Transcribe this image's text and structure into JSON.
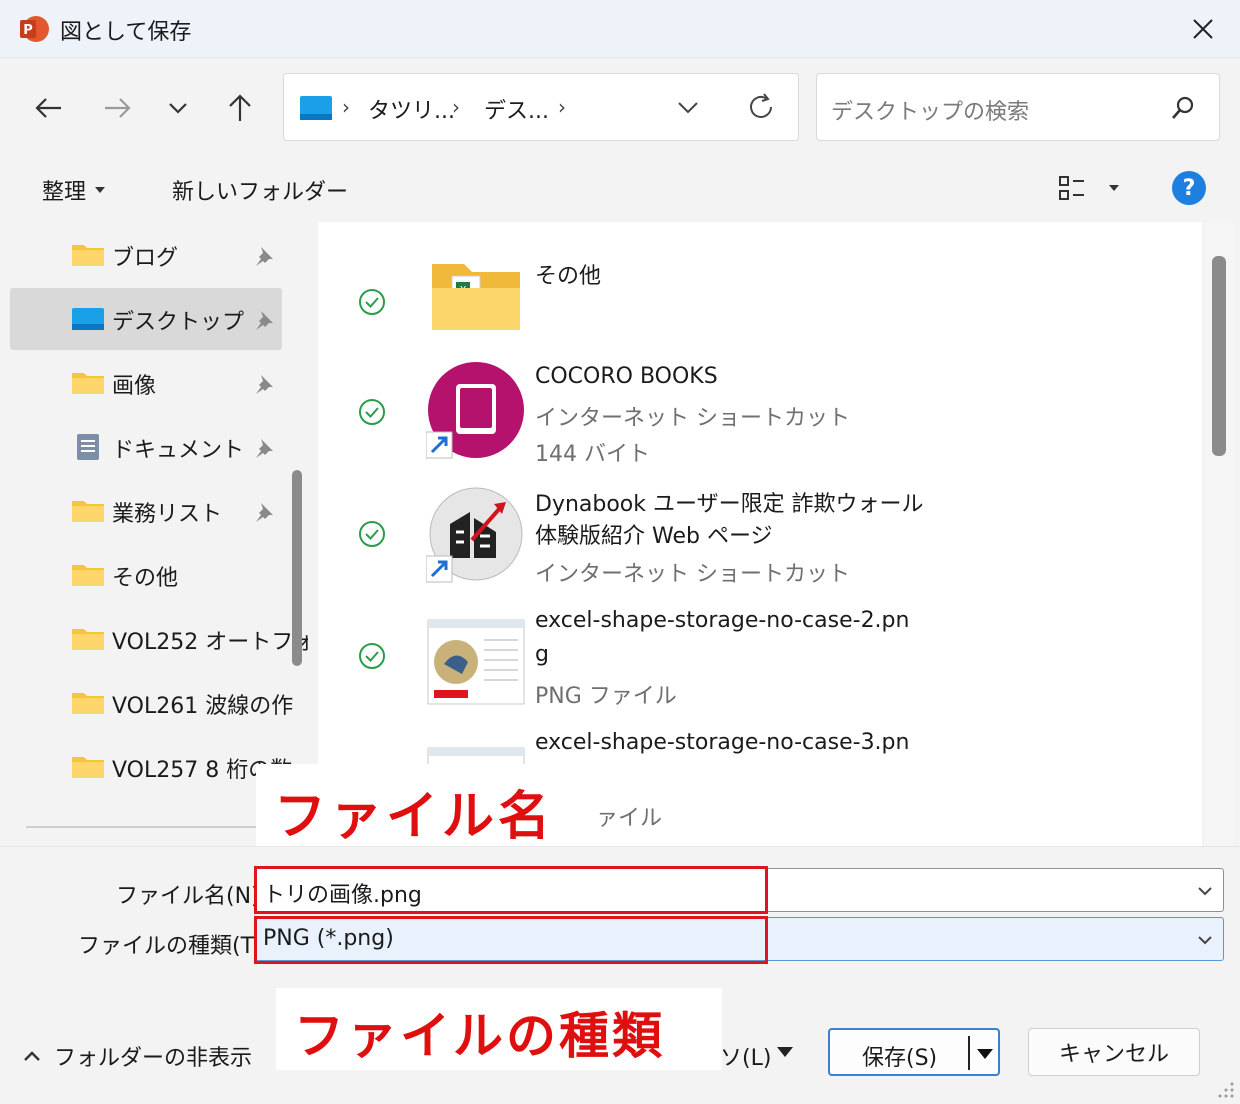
{
  "window": {
    "title": "図として保存"
  },
  "address": {
    "crumbs": [
      "タツリ...",
      "デス..."
    ]
  },
  "search": {
    "placeholder": "デスクトップの検索"
  },
  "toolbar": {
    "organize_label": "整理",
    "new_folder_label": "新しいフォルダー"
  },
  "nav": {
    "items": [
      {
        "label": "ブログ",
        "icon": "folder-icon",
        "pinned": true
      },
      {
        "label": "デスクトップ",
        "icon": "desktop-icon",
        "pinned": true,
        "selected": true
      },
      {
        "label": "画像",
        "icon": "folder-icon",
        "pinned": true
      },
      {
        "label": "ドキュメント",
        "icon": "document-icon",
        "pinned": true
      },
      {
        "label": "業務リスト",
        "icon": "folder-icon",
        "pinned": true
      },
      {
        "label": "その他",
        "icon": "folder-icon",
        "pinned": false
      },
      {
        "label": "VOL252 オートフォ",
        "icon": "folder-icon",
        "pinned": false
      },
      {
        "label": "VOL261 波線の作",
        "icon": "folder-icon",
        "pinned": false
      },
      {
        "label": "VOL257 8 桁の数",
        "icon": "folder-icon",
        "pinned": false
      }
    ]
  },
  "files": [
    {
      "name": "その他",
      "lines": [],
      "icon": "folder-excel-icon"
    },
    {
      "name": "COCORO BOOKS",
      "lines": [
        "インターネット ショートカット",
        "144 バイト"
      ],
      "icon": "cocoro-books-icon"
    },
    {
      "name": "Dynabook ユーザー限定 詐欺ウォール",
      "name2": "体験版紹介 Web ページ",
      "lines": [
        "インターネット ショートカット"
      ],
      "icon": "dynabook-icon"
    },
    {
      "name": "excel-shape-storage-no-case-2.pn",
      "name2": "g",
      "lines": [
        "PNG ファイル"
      ],
      "icon": "png-thumbnail-icon"
    },
    {
      "name": "excel-shape-storage-no-case-3.pn",
      "lines": [
        "ァイル"
      ],
      "icon": "png-thumbnail-icon"
    }
  ],
  "annotations": {
    "filename_label": "ファイル名",
    "filetype_label": "ファイルの種類"
  },
  "form": {
    "filename_label": "ファイル名(N):",
    "filename_value": "トリの画像.png",
    "filetype_label": "ファイルの種類(T):",
    "filetype_value": "PNG (*.png)"
  },
  "footer": {
    "hide_folders_label": "フォルダーの非表示",
    "tools_fragment": "ソ(L)",
    "save_label": "保存(S)",
    "cancel_label": "キャンセル"
  },
  "colors": {
    "accent": "#1d7fe0",
    "annotation_red": "#e00f0f",
    "selected_bg": "#d9d9d9"
  }
}
